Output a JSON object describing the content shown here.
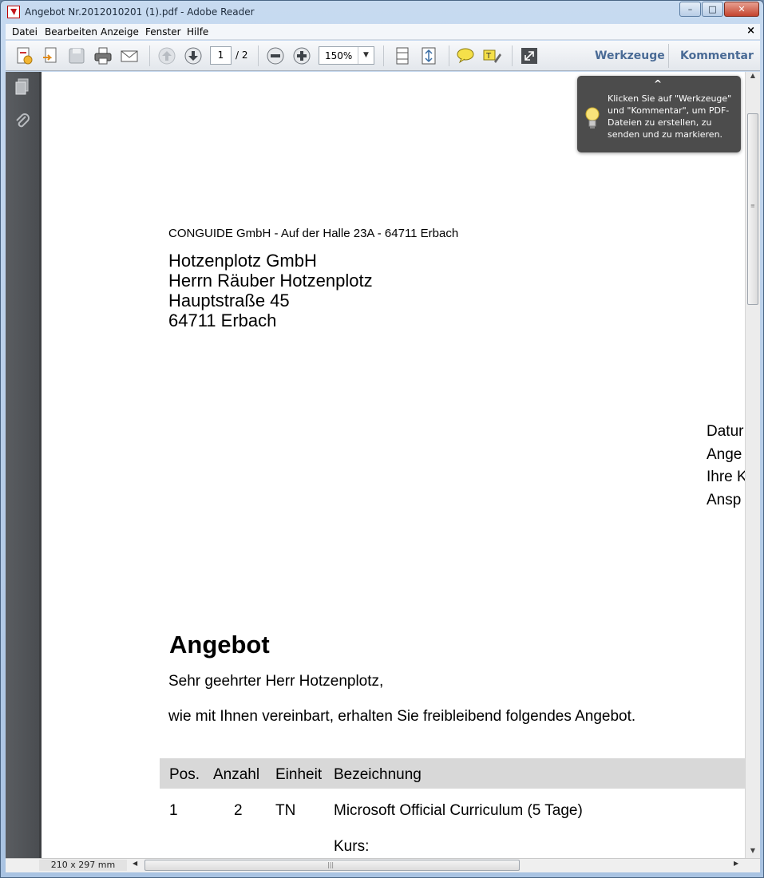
{
  "window": {
    "title": "Angebot Nr.2012010201 (1).pdf - Adobe Reader",
    "controls": {
      "minimize": "–",
      "maximize": "□",
      "close": "✕"
    }
  },
  "menu": {
    "items": [
      "Datei",
      "Bearbeiten",
      "Anzeige",
      "Fenster",
      "Hilfe"
    ],
    "close_document": "×"
  },
  "toolbar": {
    "current_page": "1",
    "page_total": "/ 2",
    "zoom": "150%",
    "tools_link": "Werkzeuge",
    "comment_link": "Kommentar",
    "icons": [
      "create-pdf-icon",
      "export-icon",
      "save-icon",
      "print-icon",
      "email-icon",
      "page-up-icon",
      "page-down-icon",
      "zoom-out-icon",
      "zoom-in-icon",
      "scroll-mode-icon",
      "fit-page-icon",
      "comment-icon",
      "highlight-icon",
      "fullscreen-icon"
    ]
  },
  "left_nav": {
    "icons": [
      "pages-panel-icon",
      "attachments-icon"
    ]
  },
  "tooltip": {
    "caret": "^",
    "text": "Klicken Sie auf \"Werkzeuge\" und \"Kommentar\", um PDF-Dateien zu erstellen, zu senden und zu markieren."
  },
  "document": {
    "sender_line": "CONGUIDE GmbH - Auf der Halle 23A - 64711 Erbach",
    "recipient": [
      "Hotzenplotz GmbH",
      "Herrn Räuber Hotzenplotz",
      "Hauptstraße 45",
      "64711 Erbach"
    ],
    "meta_fragments": [
      "Datur",
      "Ange",
      "Ihre K",
      "Ansp"
    ],
    "heading": "Angebot",
    "salutation": "Sehr geehrter Herr Hotzenplotz,",
    "intro": "wie mit Ihnen vereinbart, erhalten Sie freibleibend folgendes Angebot.",
    "table": {
      "headers": [
        "Pos.",
        "Anzahl",
        "Einheit",
        "Bezeichnung"
      ],
      "rows": [
        {
          "pos": "1",
          "anzahl": "2",
          "einheit": "TN",
          "bezeichnung": "Microsoft Official Curriculum (5 Tage)"
        }
      ],
      "continuation": "Kurs:"
    }
  },
  "statusbar": {
    "page_size": "210 x 297 mm"
  },
  "colors": {
    "tooltip_bg": "#4c4c4c",
    "link_blue": "#4a6b96",
    "nav_dark": "#555555",
    "table_header_bg": "#d8d8d8"
  }
}
